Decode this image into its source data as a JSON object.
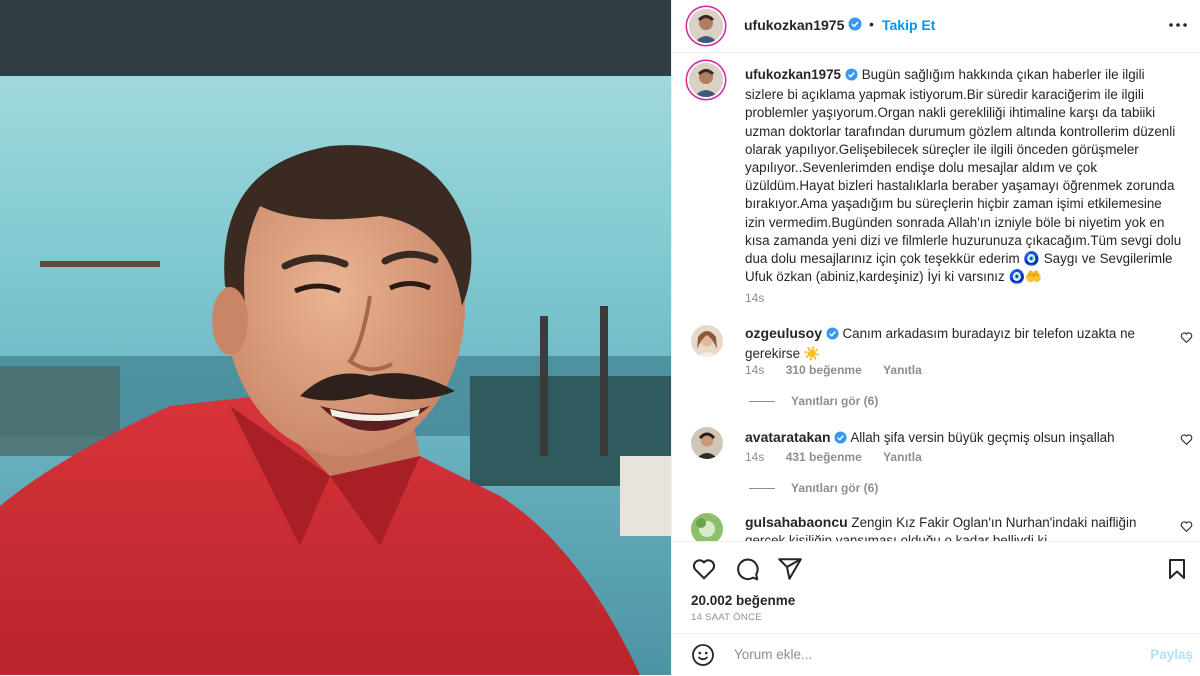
{
  "post": {
    "author": "ufukozkan1975",
    "follow_label": "Takip Et",
    "dot": "•",
    "caption": "Bugün sağlığım hakkında çıkan haberler ile ilgili sizlere bi açıklama yapmak istiyorum.Bir süredir karaciğerim ile ilgili problemler yaşıyorum.Organ nakli gerekliliği ihtimaline karşı da tabiiki uzman doktorlar tarafından durumum gözlem altında kontrollerim düzenli olarak yapılıyor.Gelişebilecek süreçler ile ilgili önceden görüşmeler yapılıyor..Sevenlerimden endişe dolu mesajlar aldım ve çok üzüldüm.Hayat bizleri hastalıklarla beraber yaşamayı öğrenmek zorunda bırakıyor.Ama yaşadığım bu süreçlerin hiçbir zaman işimi etkilemesine izin vermedim.Bugünden sonrada Allah'ın izniyle böle bi niyetim yok en kısa zamanda yeni dizi ve filmlerle huzurunuza çıkacağım.Tüm sevgi dolu dua dolu mesajlarınız için çok teşekkür ederim 🧿 Saygı ve Sevgilerimle Ufuk özkan (abiniz,kardeşiniz) İyi ki varsınız 🧿🤲",
    "caption_time": "14s",
    "likes": "20.002 beğenme",
    "posted_ago": "14 SAAT ÖNCE"
  },
  "comments": [
    {
      "user": "ozgeulusoy",
      "verified": true,
      "text": "Canım arkadasım buradayız bir telefon uzakta ne gerekirse ☀️",
      "time": "14s",
      "likes": "310 beğenme",
      "reply_label": "Yanıtla",
      "view_replies": "Yanıtları gör (6)"
    },
    {
      "user": "avataratakan",
      "verified": true,
      "text": "Allah şifa versin büyük geçmiş olsun inşallah",
      "time": "14s",
      "likes": "431 beğenme",
      "reply_label": "Yanıtla",
      "view_replies": "Yanıtları gör (6)"
    },
    {
      "user": "gulsahabaoncu",
      "verified": false,
      "text": "Zengin Kız Fakir Oglan'ın Nurhan'indaki naifliğin gercek kişiliğin yansıması olduğu o kadar bellivdi ki"
    }
  ],
  "add_comment": {
    "placeholder": "Yorum ekle...",
    "post_label": "Paylaş"
  },
  "colors": {
    "accent": "#0095f6",
    "verified": "#3897f0",
    "shirt": "#c8282e"
  }
}
